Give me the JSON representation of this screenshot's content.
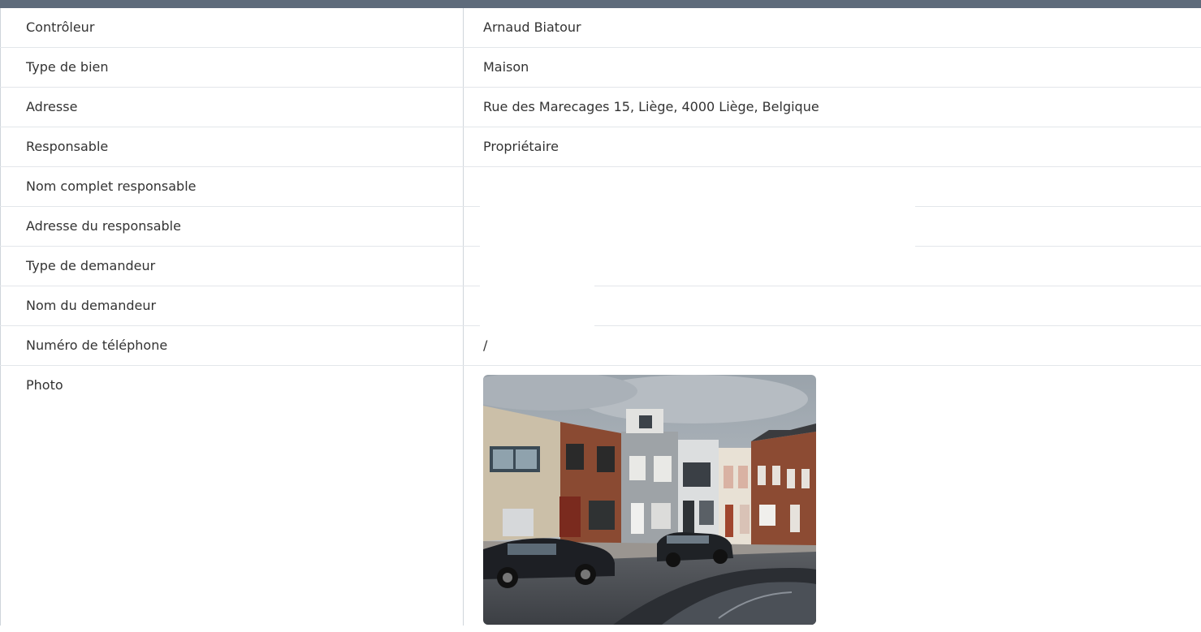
{
  "rows": [
    {
      "label": "Contrôleur",
      "value": "Arnaud Biatour"
    },
    {
      "label": "Type de bien",
      "value": "Maison"
    },
    {
      "label": "Adresse",
      "value": "Rue des Marecages 15, Liège, 4000 Liège, Belgique"
    },
    {
      "label": "Responsable",
      "value": "Propriétaire"
    },
    {
      "label": "Nom complet responsable",
      "value": ""
    },
    {
      "label": "Adresse du responsable",
      "value": ""
    },
    {
      "label": "Type de demandeur",
      "value": ""
    },
    {
      "label": "Nom du demandeur",
      "value": ""
    },
    {
      "label": "Numéro de téléphone",
      "value": "/"
    },
    {
      "label": "Photo"
    }
  ],
  "colors": {
    "header_bar": "#5e6b7b",
    "row_border": "#e3e6ea",
    "text": "#333333"
  }
}
